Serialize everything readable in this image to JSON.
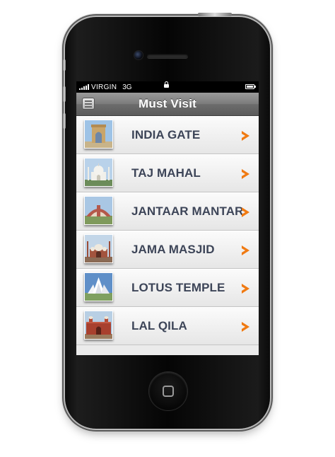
{
  "status_bar": {
    "carrier": "VIRGIN",
    "network": "3G",
    "icons": [
      "signal-icon",
      "lock-icon",
      "battery-icon"
    ]
  },
  "navbar": {
    "title": "Must Visit",
    "menu_icon": "menu-icon"
  },
  "places": [
    {
      "label": "INDIA GATE",
      "thumb": "india-gate-photo"
    },
    {
      "label": "TAJ MAHAL",
      "thumb": "taj-mahal-photo"
    },
    {
      "label": "JANTAAR MANTAR",
      "thumb": "jantar-mantar-photo"
    },
    {
      "label": "JAMA MASJID",
      "thumb": "jama-masjid-photo"
    },
    {
      "label": "LOTUS TEMPLE",
      "thumb": "lotus-temple-photo"
    },
    {
      "label": "LAL QILA",
      "thumb": "lal-qila-photo"
    }
  ],
  "colors": {
    "label_text": "#3d4558",
    "chevron": "#f07a12",
    "navbar": "#7b7b7b"
  }
}
